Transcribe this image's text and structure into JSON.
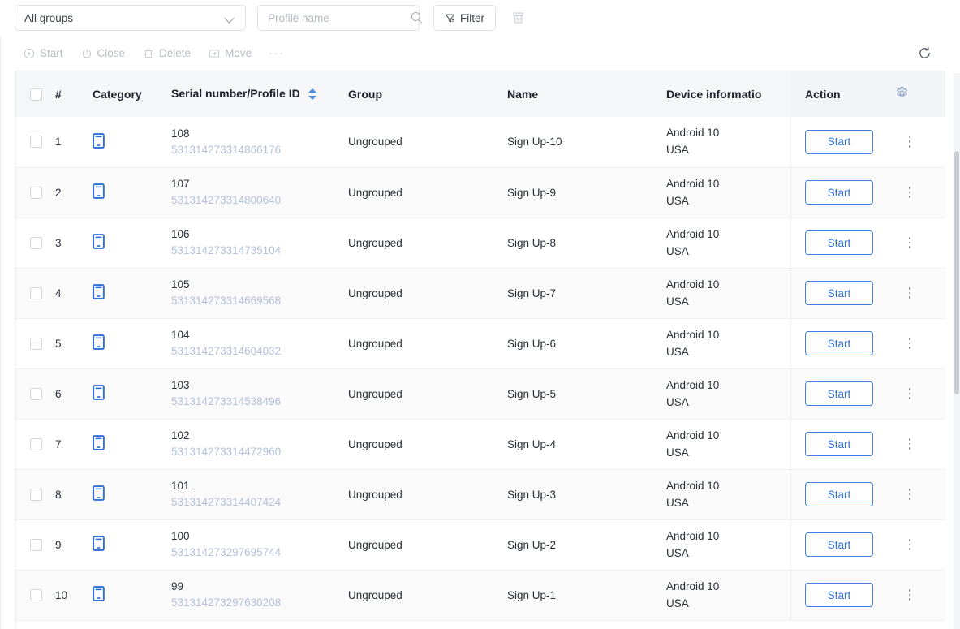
{
  "topbar": {
    "group_select": {
      "value": "All groups",
      "icon": "chevron-down-icon"
    },
    "search": {
      "placeholder": "Profile name",
      "value": "",
      "icon": "search-icon"
    },
    "filter_button": {
      "label": "Filter",
      "icon": "funnel-icon"
    },
    "trash_button": {
      "icon": "trash-icon"
    }
  },
  "toolbar": {
    "start_label": "Start",
    "close_label": "Close",
    "delete_label": "Delete",
    "move_label": "Move",
    "more_label": "···",
    "refresh_icon": "refresh-icon"
  },
  "table": {
    "columns": {
      "checkbox": "",
      "index": "#",
      "category": "Category",
      "serial": "Serial number/Profile ID",
      "group": "Group",
      "name": "Name",
      "device": "Device informatio",
      "action": "Action",
      "settings_icon": "gear-icon"
    },
    "rows": [
      {
        "index": "1",
        "category_icon": "mobile-phone-icon",
        "serial": "108",
        "profile_id": "531314273314866176",
        "group": "Ungrouped",
        "name": "Sign Up-10",
        "device_os": "Android 10",
        "device_region": "USA",
        "action": "Start"
      },
      {
        "index": "2",
        "category_icon": "mobile-phone-icon",
        "serial": "107",
        "profile_id": "531314273314800640",
        "group": "Ungrouped",
        "name": "Sign Up-9",
        "device_os": "Android 10",
        "device_region": "USA",
        "action": "Start"
      },
      {
        "index": "3",
        "category_icon": "mobile-phone-icon",
        "serial": "106",
        "profile_id": "531314273314735104",
        "group": "Ungrouped",
        "name": "Sign Up-8",
        "device_os": "Android 10",
        "device_region": "USA",
        "action": "Start"
      },
      {
        "index": "4",
        "category_icon": "mobile-phone-icon",
        "serial": "105",
        "profile_id": "531314273314669568",
        "group": "Ungrouped",
        "name": "Sign Up-7",
        "device_os": "Android 10",
        "device_region": "USA",
        "action": "Start"
      },
      {
        "index": "5",
        "category_icon": "mobile-phone-icon",
        "serial": "104",
        "profile_id": "531314273314604032",
        "group": "Ungrouped",
        "name": "Sign Up-6",
        "device_os": "Android 10",
        "device_region": "USA",
        "action": "Start"
      },
      {
        "index": "6",
        "category_icon": "mobile-phone-icon",
        "serial": "103",
        "profile_id": "531314273314538496",
        "group": "Ungrouped",
        "name": "Sign Up-5",
        "device_os": "Android 10",
        "device_region": "USA",
        "action": "Start"
      },
      {
        "index": "7",
        "category_icon": "mobile-phone-icon",
        "serial": "102",
        "profile_id": "531314273314472960",
        "group": "Ungrouped",
        "name": "Sign Up-4",
        "device_os": "Android 10",
        "device_region": "USA",
        "action": "Start"
      },
      {
        "index": "8",
        "category_icon": "mobile-phone-icon",
        "serial": "101",
        "profile_id": "531314273314407424",
        "group": "Ungrouped",
        "name": "Sign Up-3",
        "device_os": "Android 10",
        "device_region": "USA",
        "action": "Start"
      },
      {
        "index": "9",
        "category_icon": "mobile-phone-icon",
        "serial": "100",
        "profile_id": "531314273297695744",
        "group": "Ungrouped",
        "name": "Sign Up-2",
        "device_os": "Android 10",
        "device_region": "USA",
        "action": "Start"
      },
      {
        "index": "10",
        "category_icon": "mobile-phone-icon",
        "serial": "99",
        "profile_id": "531314273297630208",
        "group": "Ungrouped",
        "name": "Sign Up-1",
        "device_os": "Android 10",
        "device_region": "USA",
        "action": "Start"
      }
    ]
  },
  "colors": {
    "accent": "#2f6fdc",
    "profile_id": "#b3c1dd",
    "header_bg": "#f5f6f8",
    "disabled_text": "#b9bdc4"
  }
}
